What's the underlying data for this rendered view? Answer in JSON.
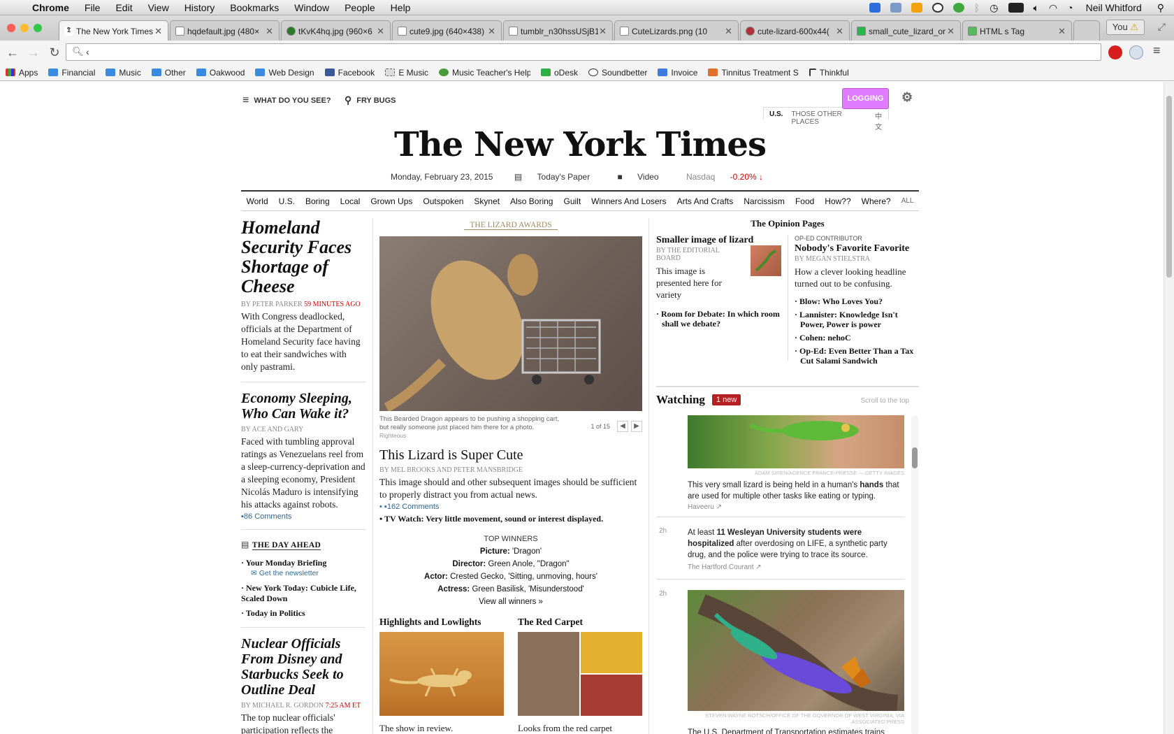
{
  "menubar": {
    "app": "Chrome",
    "items": [
      "File",
      "Edit",
      "View",
      "History",
      "Bookmarks",
      "Window",
      "People",
      "Help"
    ],
    "user": "Neil Whitford"
  },
  "tabs": [
    {
      "title": "The New York Times"
    },
    {
      "title": "hqdefault.jpg (480×"
    },
    {
      "title": "tKvK4hq.jpg (960×6"
    },
    {
      "title": "cute9.jpg (640×438)"
    },
    {
      "title": "tumblr_n30hssUSjB1"
    },
    {
      "title": "CuteLizards.png (10"
    },
    {
      "title": "cute-lizard-600x44("
    },
    {
      "title": "small_cute_lizard_or"
    },
    {
      "title": "HTML s Tag"
    }
  ],
  "profile_label": "You",
  "omnibox": {
    "value": "‹"
  },
  "bookmarks": [
    {
      "label": "Apps",
      "icon": "apps-icon"
    },
    {
      "label": "Financial",
      "icon": "folder-icon"
    },
    {
      "label": "Music",
      "icon": "folder-icon"
    },
    {
      "label": "Other",
      "icon": "folder-icon"
    },
    {
      "label": "Oakwood",
      "icon": "folder-icon"
    },
    {
      "label": "Web Design",
      "icon": "folder-icon"
    },
    {
      "label": "Facebook",
      "icon": "facebook-icon"
    },
    {
      "label": "E Music",
      "icon": "emusic-icon"
    },
    {
      "label": "Music Teacher's Help",
      "icon": "music-teacher-icon"
    },
    {
      "label": "oDesk",
      "icon": "odesk-icon"
    },
    {
      "label": "Soundbetter",
      "icon": "soundbetter-icon"
    },
    {
      "label": "Invoice",
      "icon": "invoice-icon"
    },
    {
      "label": "Tinnitus Treatment S",
      "icon": "tinnitus-icon"
    },
    {
      "label": "Thinkful",
      "icon": "thinkful-icon"
    }
  ],
  "masthead": {
    "sections_label": "WHAT DO YOU SEE?",
    "search_label": "FRY BUGS",
    "login_label": "LOGGING",
    "editions": [
      "U.S.",
      "THOSE OTHER PLACES",
      "中文"
    ],
    "logo": "The New York Times",
    "date": "Monday, February 23, 2015",
    "todays_paper": "Today's Paper",
    "video": "Video",
    "nasdaq_label": "Nasdaq",
    "nasdaq_value": "-0.20% ↓"
  },
  "section_nav": [
    "World",
    "U.S.",
    "Boring",
    "Local",
    "Grown Ups",
    "Outspoken",
    "Skynet",
    "Also Boring",
    "Guilt",
    "Winners And Losers",
    "Arts And Crafts",
    "Narcissism",
    "Food",
    "How??",
    "Where?"
  ],
  "section_nav_all": "ALL",
  "left_column": {
    "story1": {
      "headline": "Homeland Security Faces Shortage of Cheese",
      "byline": "By PETER PARKER",
      "time": "59 minutes ago",
      "summary": "With Congress deadlocked, officials at the Department of Homeland Security face having to eat their sandwiches with only pastrami."
    },
    "story2": {
      "headline": "Economy Sleeping, Who Can Wake it?",
      "byline": "By ACE and GARY",
      "summary": "Faced with tumbling approval ratings as Venezuelans reel from a sleep-currency-deprivation and a sleeping economy, President Nicolás Maduro is intensifying his attacks against robots.",
      "comments": "86 Comments"
    },
    "day_ahead": {
      "title": "THE DAY AHEAD",
      "items": [
        "Your Monday Briefing",
        "New York Today: Cubicle Life, Scaled Down",
        "Today in Politics"
      ],
      "newsletter": "Get the newsletter"
    },
    "story3": {
      "headline": "Nuclear Officials From Disney and Starbucks Seek to Outline Deal",
      "byline": "By MICHAEL R. GORDON",
      "time": "7:25 AM ET",
      "summary": "The top nuclear officials' participation reflects the"
    }
  },
  "center": {
    "kicker": "THE LIZARD AWARDS",
    "caption": "This Bearded Dragon appears to be pushing a shopping cart, but really someone just placed him there for a photo.",
    "credit": "Righteous",
    "slide_counter": "1 of 15",
    "headline": "This Lizard is Super Cute",
    "byline": "By MEL BROOKS and PETER MANSBRIDGE",
    "summary": "This image should and other subsequent images should be sufficient to properly distract you from actual news.",
    "comments": "162 Comments",
    "bullet": "TV Watch: Very little movement, sound or interest displayed.",
    "awards": {
      "title": "TOP WINNERS",
      "rows": [
        {
          "k": "Picture:",
          "v": "'Dragon'"
        },
        {
          "k": "Director:",
          "v": "Green Anole, \"Dragon\""
        },
        {
          "k": "Actor:",
          "v": "Crested Gecko, 'Sitting, unmoving, hours'"
        },
        {
          "k": "Actress:",
          "v": "Green Basilisk, 'Misunderstood'"
        }
      ],
      "view_all": "View all winners »"
    },
    "mini1": {
      "title": "Highlights and Lowlights",
      "summary": "The show in review."
    },
    "mini2": {
      "title": "The Red Carpet",
      "summary": "Looks from the red carpet"
    }
  },
  "opinion": {
    "title": "The Opinion Pages",
    "left": {
      "headline": "Smaller image of lizard",
      "byline": "By THE EDITORIAL BOARD",
      "summary": "This image is presented here for variety",
      "bullet": "Room for Debate: In which room shall we debate?"
    },
    "right": {
      "kicker": "OP-ED CONTRIBUTOR",
      "headline": "Nobody's Favorite Favorite",
      "byline": "By MEGAN STIELSTRA",
      "summary": "How a clever looking headline turned out to be confusing.",
      "bullets": [
        "Blow: Who Loves You?",
        "Lannister: Knowledge Isn't Power, Power is power",
        "Cohen: nehoC",
        "Op-Ed: Even Better Than a Tax Cut Salami Sandwich"
      ]
    }
  },
  "watching": {
    "title": "Watching",
    "badge": "1 new",
    "scroll_top": "Scroll to the top",
    "item1": {
      "credit": "ADAM SIREN/AGENCE FRANCE-PRESSE — GETTY IMAGES",
      "text_a": "This very small lizard is being held in a human's ",
      "text_b": "hands",
      "text_c": " that are used for multiple other tasks like eating or typing.",
      "source": "Haveeru ↗"
    },
    "item2": {
      "age": "2h",
      "text_a": "At least ",
      "text_b": "11 Wesleyan University students were hospitalized",
      "text_c": " after overdosing on LIFE, a synthetic party drug, and the police were trying to trace its source.",
      "source": "The Hartford Courant ↗"
    },
    "item3": {
      "age": "2h",
      "credit": "STEVEN WAYNE ROTSCH/OFFICE OF THE GOVERNOR OF WEST VIRGINIA, VIA ASSOCIATED PRESS",
      "text": "The U.S. Department of Transportation estimates trains"
    }
  },
  "colors": {
    "accent_login": "#e07dff",
    "badge_red": "#b52020",
    "link_blue": "#326891",
    "kicker_gold": "#a08b5d"
  }
}
